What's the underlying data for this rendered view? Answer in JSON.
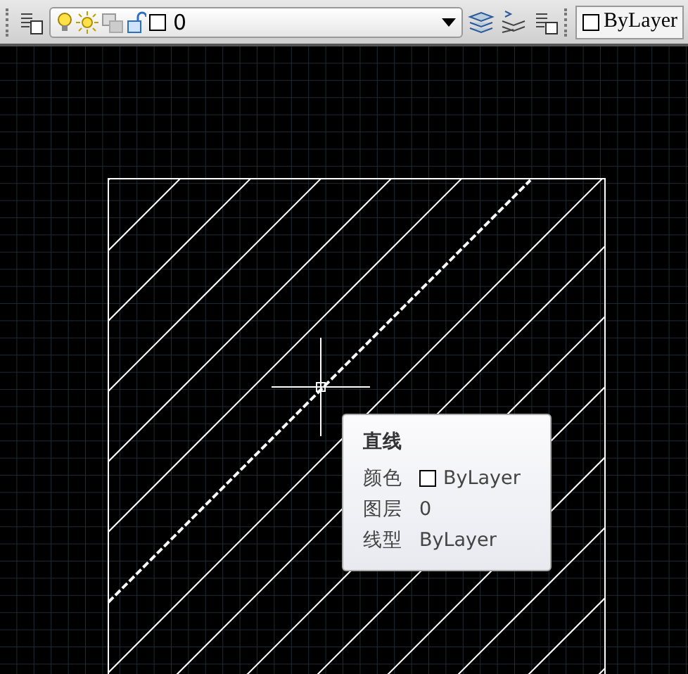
{
  "toolbar": {
    "layer_name": "0",
    "color_value": "ByLayer"
  },
  "tooltip": {
    "title": "直线",
    "properties": [
      {
        "label": "颜色",
        "value": "ByLayer",
        "kind": "color"
      },
      {
        "label": "图层",
        "value": "0",
        "kind": "text"
      },
      {
        "label": "线型",
        "value": "ByLayer",
        "kind": "text"
      }
    ]
  }
}
